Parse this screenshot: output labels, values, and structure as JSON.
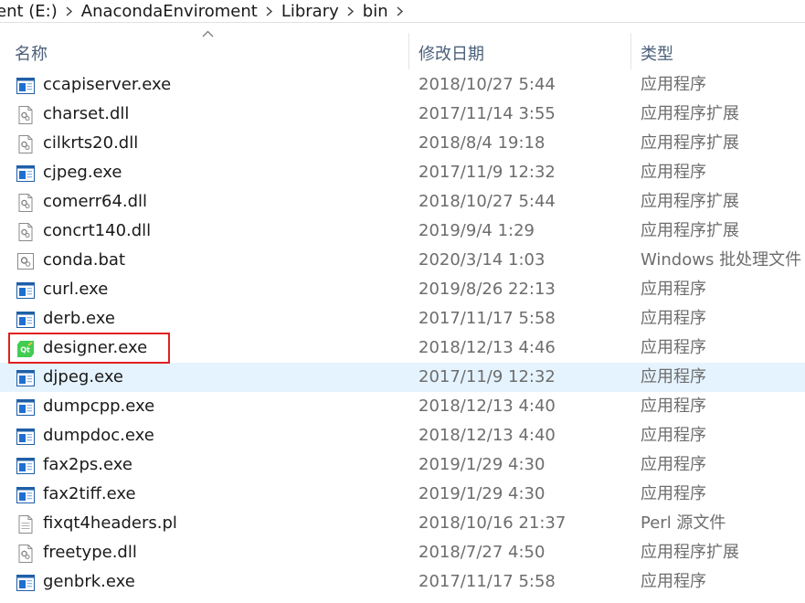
{
  "breadcrumb": {
    "items": [
      "ent (E:)",
      "AnacondaEnviroment",
      "Library",
      "bin"
    ]
  },
  "columns": {
    "name": "名称",
    "date": "修改日期",
    "type": "类型"
  },
  "files": [
    {
      "name": "ccapiserver.exe",
      "date": "2018/10/27 5:44",
      "type": "应用程序",
      "icon": "exe-icon"
    },
    {
      "name": "charset.dll",
      "date": "2017/11/14 3:55",
      "type": "应用程序扩展",
      "icon": "dll-icon"
    },
    {
      "name": "cilkrts20.dll",
      "date": "2018/8/4 19:18",
      "type": "应用程序扩展",
      "icon": "dll-icon"
    },
    {
      "name": "cjpeg.exe",
      "date": "2017/11/9 12:32",
      "type": "应用程序",
      "icon": "exe-icon"
    },
    {
      "name": "comerr64.dll",
      "date": "2018/10/27 5:44",
      "type": "应用程序扩展",
      "icon": "dll-icon"
    },
    {
      "name": "concrt140.dll",
      "date": "2019/9/4 1:29",
      "type": "应用程序扩展",
      "icon": "dll-icon"
    },
    {
      "name": "conda.bat",
      "date": "2020/3/14 1:03",
      "type": "Windows 批处理文件",
      "icon": "bat-icon"
    },
    {
      "name": "curl.exe",
      "date": "2019/8/26 22:13",
      "type": "应用程序",
      "icon": "exe-icon"
    },
    {
      "name": "derb.exe",
      "date": "2017/11/17 5:58",
      "type": "应用程序",
      "icon": "exe-icon"
    },
    {
      "name": "designer.exe",
      "date": "2018/12/13 4:46",
      "type": "应用程序",
      "icon": "qt-designer-icon"
    },
    {
      "name": "djpeg.exe",
      "date": "2017/11/9 12:32",
      "type": "应用程序",
      "icon": "exe-icon"
    },
    {
      "name": "dumpcpp.exe",
      "date": "2018/12/13 4:40",
      "type": "应用程序",
      "icon": "exe-icon"
    },
    {
      "name": "dumpdoc.exe",
      "date": "2018/12/13 4:40",
      "type": "应用程序",
      "icon": "exe-icon"
    },
    {
      "name": "fax2ps.exe",
      "date": "2019/1/29 4:30",
      "type": "应用程序",
      "icon": "exe-icon"
    },
    {
      "name": "fax2tiff.exe",
      "date": "2019/1/29 4:30",
      "type": "应用程序",
      "icon": "exe-icon"
    },
    {
      "name": "fixqt4headers.pl",
      "date": "2018/10/16 21:37",
      "type": "Perl 源文件",
      "icon": "text-file-icon"
    },
    {
      "name": "freetype.dll",
      "date": "2018/7/27 4:50",
      "type": "应用程序扩展",
      "icon": "dll-icon"
    },
    {
      "name": "genbrk.exe",
      "date": "2017/11/17 5:58",
      "type": "应用程序",
      "icon": "exe-icon"
    }
  ],
  "state": {
    "hovered_file": "djpeg.exe",
    "annotated_file": "designer.exe"
  },
  "colors": {
    "hover": "#e5f3ff",
    "annotation": "#e02020",
    "header_text": "#4c607a",
    "meta_text": "#6d6d6d"
  }
}
